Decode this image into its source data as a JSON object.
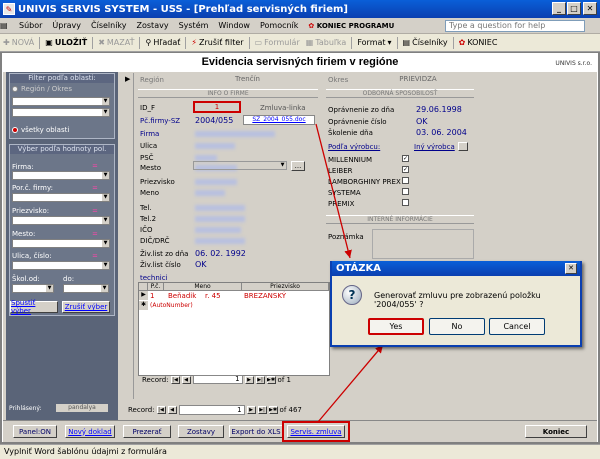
{
  "window": {
    "title": "UNIVIS SERVIS SYSTEM - USS - [Prehľad servisných firiem]"
  },
  "menu": {
    "items": [
      "Súbor",
      "Úpravy",
      "Číselníky",
      "Zostavy",
      "Systém",
      "Window",
      "Pomocník",
      "KONIEC PROGRAMU"
    ],
    "help_placeholder": "Type a question for help"
  },
  "toolbar": {
    "nova": "NOVÁ",
    "ulozit": "ULOŽIŤ",
    "mazat": "MAZAŤ",
    "hladat": "Hľadať",
    "zrusit_filter": "Zrušiť filter",
    "formular": "Formulár",
    "tabulka": "Tabuľka",
    "format": "Format",
    "ciselniky": "Číselníky",
    "koniec": "KONIEC"
  },
  "form": {
    "title": "Evidencia servisných firiem v regióne",
    "brand": "UNIVIS s.r.o."
  },
  "filter": {
    "title1": "Filter podľa oblasti:",
    "region_radio": "Región / Okres",
    "all_radio": "všetky oblasti",
    "title2": "Výber podľa hodnoty pol.",
    "labels": [
      "Firma:",
      "Por.č. firmy:",
      "Priezvisko:",
      "Mesto:",
      "Ulica, číslo:"
    ],
    "eq": "=",
    "skol_od": "Škol.od:",
    "do": "do:",
    "spustit": "Spustiť výber",
    "zrusit": "Zrušiť výber",
    "prihlaseny": "Prihlásený:",
    "user": "pandalya"
  },
  "record": {
    "region_label": "Región",
    "region_value": "Trenčín",
    "okres_label": "Okres",
    "okres_value": "PRIEVIDZA",
    "info_hdr": "INFO O FIRME",
    "id_label": "ID_F",
    "id_value": "1",
    "zmluva_link_label": "Zmluva-linka",
    "pc_label": "Pč.firmy-SZ",
    "pc_value": "2004/055",
    "doc_link": "SZ_2004_055.doc",
    "firma_label": "Firma",
    "ulica_label": "Ulica",
    "psc_label": "PSČ",
    "mesto_label": "Mesto",
    "priezvisko_label": "Priezvisko",
    "meno_label": "Meno",
    "tel_label": "Tel.",
    "tel2_label": "Tel.2",
    "ico_label": "IČO",
    "dic_label": "DIČ/DRČ",
    "ziv_zo_dna_label": "Živ.list zo dňa",
    "ziv_zo_dna_value": "06. 02. 1992",
    "ziv_cislo_label": "Živ.list číslo",
    "ziv_cislo_value": "OK",
    "sposob_hdr": "ODBORNÁ SPOSOBILOSŤ",
    "opr_zo_dna_label": "Oprávnenie zo dňa",
    "opr_zo_dna_value": "29.06.1998",
    "opr_cislo_label": "Oprávnenie číslo",
    "opr_cislo_value": "OK",
    "skolenie_label": "Školenie dňa",
    "skolenie_value": "03. 06. 2004",
    "podla_vyrobcu_label": "Podľa výrobcu:",
    "iny_vyrobca_label": "Iný výrobca",
    "vyrobcovia": [
      {
        "name": "MILLENNIUM",
        "checked": "✓"
      },
      {
        "name": "LEIBER",
        "checked": "✓"
      },
      {
        "name": "LAMBORGHINY PREX",
        "checked": ""
      },
      {
        "name": "SYSTEMA",
        "checked": ""
      },
      {
        "name": "PREMIX",
        "checked": ""
      }
    ],
    "interne_hdr": "INTERNÉ INFORMÁCIE",
    "poznamka_label": "Poznámka"
  },
  "technici": {
    "label": "technici",
    "headers": [
      "P.č.",
      "Meno",
      "Priezvisko"
    ],
    "row1": {
      "pc": "1",
      "meno": "Beňadik",
      "ulica": "r. 45",
      "priezvisko": "BREZANSKÝ"
    },
    "row2": {
      "pc": "(AutoNumber)"
    },
    "nav": {
      "record_label": "Record:",
      "current": "1",
      "of_label": "of 1"
    }
  },
  "mainnav": {
    "record_label": "Record:",
    "current": "1",
    "of_label": "of 467"
  },
  "dialog": {
    "title": "OTÁZKA",
    "message": "Generovať zmluvu pre zobrazenú položku '2004/055' ?",
    "yes": "Yes",
    "no": "No",
    "cancel": "Cancel"
  },
  "bottom": {
    "panel": "Panel:ON",
    "novy_doklad": "Nový doklad",
    "prezerat": "Prezerať",
    "zostavy": "Zostavy",
    "export": "Export do XLS",
    "servis_zmluva": "Servis. zmluva",
    "koniec": "Koniec"
  },
  "status": "Vyplniť Word šablónu údajmi z formulára"
}
